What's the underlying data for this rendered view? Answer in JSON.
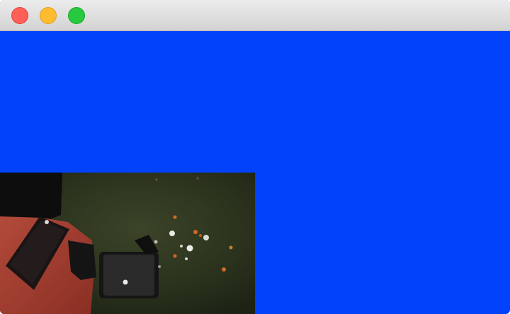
{
  "window": {
    "controls": [
      {
        "name": "close",
        "color": "#ff5f57",
        "border": "#e0443e"
      },
      {
        "name": "minimize",
        "color": "#febc2e",
        "border": "#dea123"
      },
      {
        "name": "zoom",
        "color": "#28c840",
        "border": "#1aab29"
      }
    ]
  },
  "content": {
    "background_color": "#0342fb",
    "video_frame": {
      "description_icon": "camera-feed-image"
    }
  }
}
